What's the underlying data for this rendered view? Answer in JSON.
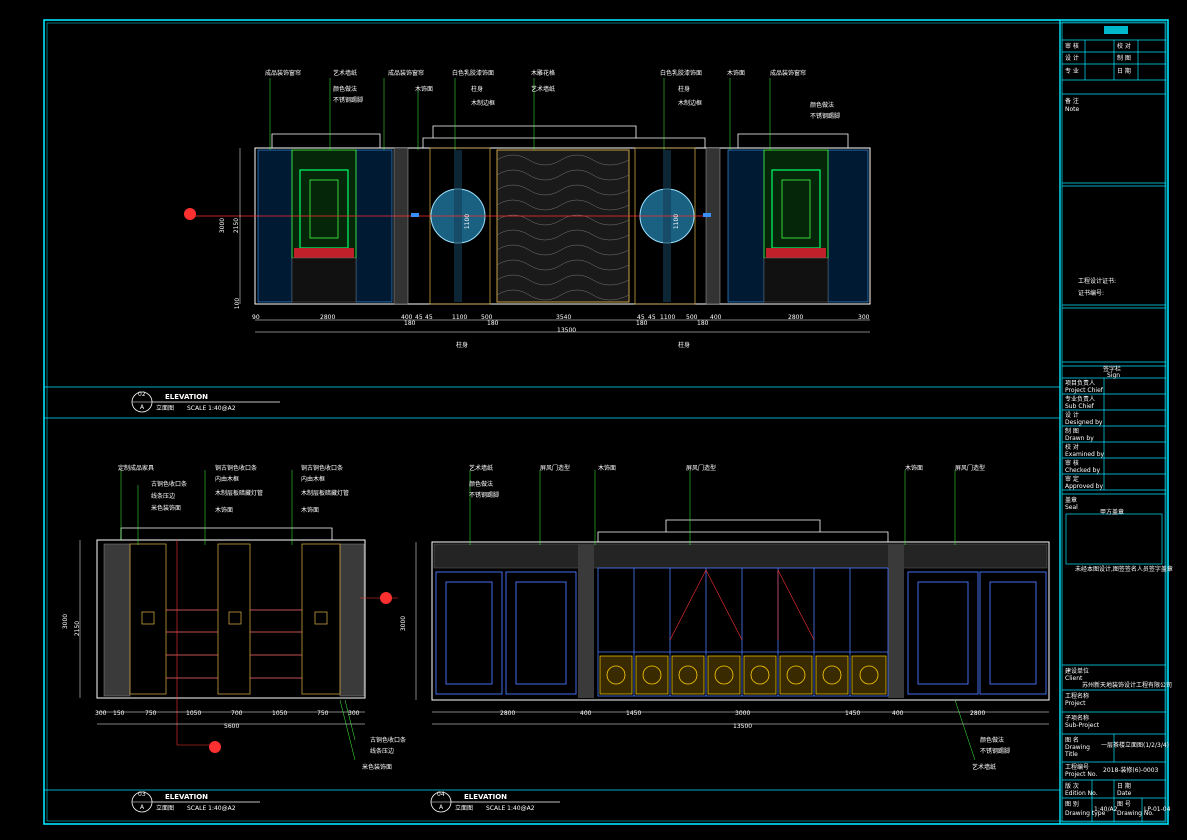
{
  "colors": {
    "background": "#000000",
    "frame": "#00e5ff",
    "leader": "#3fff3f",
    "dim": "#ffffff",
    "axis": "#ff3030",
    "pattern": "#ffd200",
    "panel": "#4a78ff"
  },
  "elevation1": {
    "labels": [
      "成品装饰窗帘",
      "艺术墙纸",
      "成品装饰窗帘",
      "白色乳胶漆饰面",
      "木雕花格",
      "白色乳胶漆饰面",
      "木饰面",
      "成品装饰窗帘"
    ],
    "sublabels": [
      "颜色做法",
      "不锈钢踢脚",
      "木饰面",
      "柱身",
      "木制边框",
      "艺术墙纸",
      "柱身",
      "木制边框",
      "颜色做法",
      "不锈钢踢脚"
    ],
    "dims": [
      "90",
      "2800",
      "400",
      "45",
      "45",
      "1100",
      "500",
      "3540",
      "45",
      "45",
      "1100",
      "500",
      "400",
      "2800",
      "300"
    ],
    "subtotals": [
      "180",
      "180",
      "180",
      "180"
    ],
    "total": "13500",
    "column_labels": [
      "柱身",
      "柱身"
    ],
    "heights": [
      "3000",
      "2150",
      "100"
    ],
    "circle_labels": [
      "1100",
      "1100"
    ]
  },
  "elevation2": {
    "labels": [
      "定制成品家具",
      "古铜色收口条",
      "线条压边",
      "米色装饰面",
      "铜古铜色收口条",
      "内由木框",
      "木制层板暗藏灯管",
      "木饰面",
      "铜古铜色收口条",
      "内由木框",
      "木制层板暗藏灯管",
      "木饰面"
    ],
    "dims": [
      "300",
      "150",
      "750",
      "1050",
      "700",
      "1050",
      "750",
      "300"
    ],
    "total": "5600",
    "heights": [
      "3000",
      "2150"
    ],
    "bottom_labels": [
      "古铜色收口条",
      "线条压边",
      "米色装饰面"
    ]
  },
  "elevation3": {
    "labels": [
      "艺术墙纸",
      "颜色做法",
      "不锈钢踢脚",
      "屏风门造型",
      "木饰面",
      "屏风门造型",
      "木饰面",
      "屏风门造型"
    ],
    "dims": [
      "2800",
      "400",
      "1450",
      "3000",
      "1450",
      "400",
      "2800"
    ],
    "total": "13500",
    "heights": [
      "3000"
    ],
    "bottom_labels": [
      "颜色做法",
      "不锈钢踢脚",
      "艺术墙纸"
    ]
  },
  "titles": [
    {
      "num": "02",
      "sheet": "A",
      "en": "ELEVATION",
      "cn": "立面图",
      "scale": "SCALE 1:40@A2"
    },
    {
      "num": "03",
      "sheet": "A",
      "en": "ELEVATION",
      "cn": "立面图",
      "scale": "SCALE 1:40@A2"
    },
    {
      "num": "04",
      "sheet": "A",
      "en": "ELEVATION",
      "cn": "立面图",
      "scale": "SCALE 1:40@A2"
    }
  ],
  "title_block": {
    "top_rows": [
      [
        "审 核",
        "校 对"
      ],
      [
        "设 计",
        "制 图"
      ],
      [
        "专 业",
        "日 期"
      ]
    ],
    "notes_label": "备 注",
    "notes_en": "Note",
    "cert_label": "工程设计证书:",
    "cert_no": "证书编号:",
    "sign_label": "签字栏",
    "sign_en": "Sign",
    "roles": [
      [
        "项目负责人",
        "Project Chief"
      ],
      [
        "专业负责人",
        "Sub Chief"
      ],
      [
        "设 计",
        "Designed by"
      ],
      [
        "制 图",
        "Drawn by"
      ],
      [
        "校 对",
        "Examined by"
      ],
      [
        "审 核",
        "Checked by"
      ],
      [
        "审 定",
        "Approved by"
      ]
    ],
    "seal_label": "盖章",
    "seal_en": "Seal",
    "seal_text": "甲方盖章",
    "seal_note": "未经本图设计,图签签名人员签字盖章",
    "client_label": "建设单位",
    "client_en": "Client",
    "client_name": "苏州新天地装饰设计工程有限公司",
    "project_label": "工程名称",
    "project_en": "Project",
    "subproject_label": "子项名称",
    "subproject_en": "Sub-Project",
    "drawing_label": "图 名",
    "drawing_en": "Drawing Title",
    "drawing_title": "一层茶楼立面图(1/2/3/4)",
    "projno_label": "工程编号",
    "projno_en": "Project No.",
    "projno": "2018-装修(6)-0003",
    "edition_label": "版 次",
    "edition_en": "Edition No.",
    "date_label": "日 期",
    "date_en": "Date",
    "type_label": "图 别",
    "type_en": "Drawing type",
    "type_value": "1:40/A2",
    "no_label": "图 号",
    "no_en": "Drawing No.",
    "no_value": "LP-01-04"
  }
}
